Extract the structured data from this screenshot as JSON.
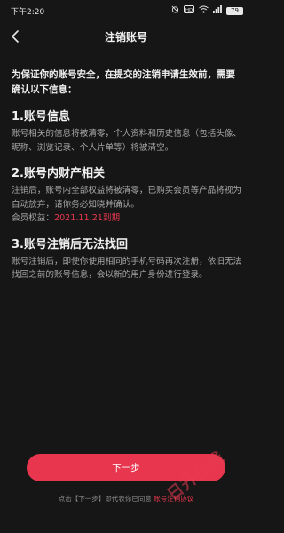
{
  "status_bar": {
    "time": "下午2:20",
    "icons": [
      "alarm-off-icon",
      "hd-icon",
      "wifi-icon",
      "signal-icon"
    ],
    "battery": "79"
  },
  "nav": {
    "title": "注销账号",
    "back_icon": "chevron-left-icon"
  },
  "intro": "为保证你的账号安全，在提交的注销申请生效前，需要确认以下信息：",
  "sections": [
    {
      "title": "1.账号信息",
      "body": "账号相关的信息将被清零，个人资料和历史信息（包括头像、昵称、浏览记录、个人片单等）将被清空。"
    },
    {
      "title": "2.账号内财产相关",
      "body": "注销后，账号内全部权益将被清零，已购买会员等产品将视为自动放弃，请你务必知晓并确认。",
      "member_label": "会员权益：",
      "member_value": "2021.11.21到期"
    },
    {
      "title": "3.账号注销后无法找回",
      "body": "账号注销后，即使你使用相同的手机号码再次注册，依旧无法找回之前的账号信息，会以新的用户身份进行登录。"
    }
  ],
  "next_button": "下一步",
  "agreement": {
    "prefix": "点击【下一步】即代表你已同意",
    "link": "账号注销协议"
  },
  "watermark": "日升在线",
  "colors": {
    "background": "#161616",
    "accent": "#e8364f"
  }
}
